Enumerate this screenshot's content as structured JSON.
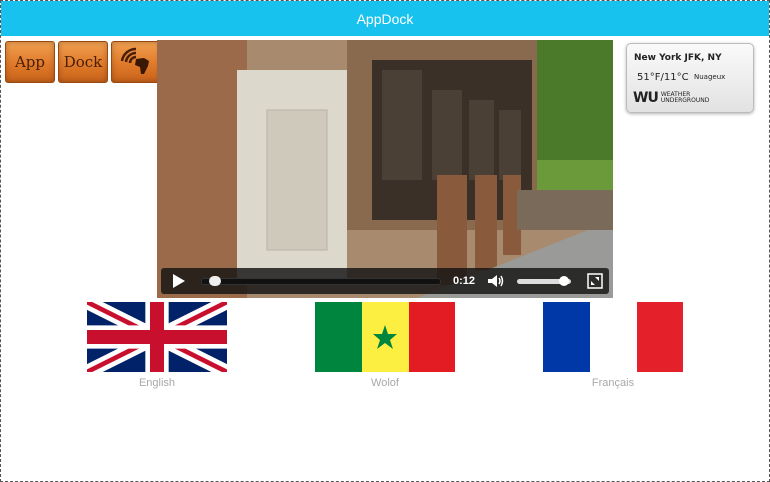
{
  "app": {
    "title": "AppDock"
  },
  "tiles": [
    {
      "label": "App"
    },
    {
      "label": "Dock"
    },
    {
      "label": "",
      "icon": "africa-signal-icon"
    }
  ],
  "video": {
    "current_time": "0:12",
    "progress_fraction": 0.03,
    "volume_fraction": 0.95
  },
  "weather": {
    "location": "New York JFK, NY",
    "temperature": "51°F/11°C",
    "condition": "Nuageux",
    "logo_mark": "WU",
    "logo_brand_line1": "WEATHER",
    "logo_brand_line2": "UNDERGROUND"
  },
  "languages": [
    {
      "label": "English"
    },
    {
      "label": "Wolof"
    },
    {
      "label": "Français"
    }
  ],
  "colors": {
    "titlebar": "#17c2ee",
    "tile": "#e07a2a",
    "flag_label": "#a8a8a8"
  }
}
